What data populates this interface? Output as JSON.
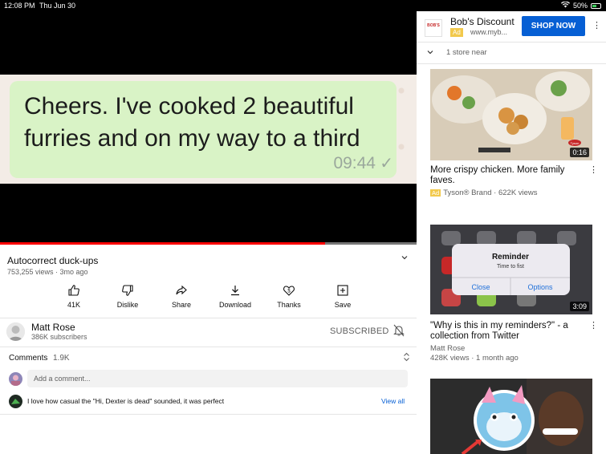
{
  "status_bar": {
    "time": "12:08 PM",
    "date": "Thu Jun 30",
    "battery": "50%"
  },
  "player": {
    "caption_line1": "Cheers. I've cooked 2 beautiful",
    "caption_line2": "furries and on my way to a third",
    "caption_timestamp": "09:44",
    "progress": 0.78
  },
  "video": {
    "title": "Autocorrect duck-ups",
    "meta": "753,255 views · 3mo ago"
  },
  "actions": [
    {
      "label": "41K",
      "icon": "thumbs-up-icon"
    },
    {
      "label": "Dislike",
      "icon": "thumbs-down-icon"
    },
    {
      "label": "Share",
      "icon": "share-icon"
    },
    {
      "label": "Download",
      "icon": "download-icon"
    },
    {
      "label": "Thanks",
      "icon": "thanks-icon"
    },
    {
      "label": "Save",
      "icon": "save-icon"
    }
  ],
  "channel": {
    "name": "Matt Rose",
    "subscribers": "386K subscribers",
    "subscribed_label": "SUBSCRIBED"
  },
  "comments": {
    "heading": "Comments",
    "count": "1.9K",
    "placeholder": "Add a comment...",
    "top_comment": "I love how casual the \"Hi, Dexter is dead\" sounded, it was perfect",
    "view_all": "View all"
  },
  "ad": {
    "logo_text": "BOB'S",
    "title": "Bob's Discount",
    "badge": "Ad",
    "url": "www.myb...",
    "cta": "SHOP NOW",
    "store_note": "1 store near"
  },
  "recommendations": [
    {
      "title": "More crispy chicken. More family faves.",
      "badge": "Ad",
      "meta": "Tyson® Brand · 622K views",
      "duration": "0:16",
      "thumb_label": "Tyson"
    },
    {
      "title": "\"Why is this in my reminders?\" - a collection from Twitter",
      "channel": "Matt Rose",
      "meta": "428K views · 1 month ago",
      "duration": "3:09",
      "dialog_title": "Reminder",
      "dialog_body": "Time to fist",
      "dialog_close": "Close",
      "dialog_options": "Options"
    }
  ],
  "colors": {
    "accent": "#065fd4",
    "progress": "#ff0000",
    "ad_badge": "#f2c94c"
  }
}
